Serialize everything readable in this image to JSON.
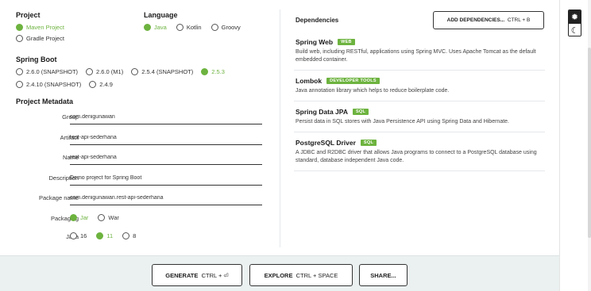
{
  "project": {
    "title": "Project",
    "options": [
      {
        "label": "Maven Project",
        "selected": true
      },
      {
        "label": "Gradle Project",
        "selected": false
      }
    ]
  },
  "language": {
    "title": "Language",
    "options": [
      {
        "label": "Java",
        "selected": true
      },
      {
        "label": "Kotlin",
        "selected": false
      },
      {
        "label": "Groovy",
        "selected": false
      }
    ]
  },
  "spring_boot": {
    "title": "Spring Boot",
    "options": [
      {
        "label": "2.6.0 (SNAPSHOT)",
        "selected": false
      },
      {
        "label": "2.6.0 (M1)",
        "selected": false
      },
      {
        "label": "2.5.4 (SNAPSHOT)",
        "selected": false
      },
      {
        "label": "2.5.3",
        "selected": true
      },
      {
        "label": "2.4.10 (SNAPSHOT)",
        "selected": false
      },
      {
        "label": "2.4.9",
        "selected": false
      }
    ]
  },
  "metadata": {
    "title": "Project Metadata",
    "fields": [
      {
        "label": "Group",
        "value": "com.denigunawan"
      },
      {
        "label": "Artifact",
        "value": "rest-api-sederhana"
      },
      {
        "label": "Name",
        "value": "rest-api-sederhana"
      },
      {
        "label": "Description",
        "value": "Demo project for Spring Boot"
      },
      {
        "label": "Package name",
        "value": "com.denigunawan.rest-api-sederhana"
      }
    ],
    "packaging": {
      "label": "Packaging",
      "options": [
        {
          "label": "Jar",
          "selected": true
        },
        {
          "label": "War",
          "selected": false
        }
      ]
    },
    "java": {
      "label": "Java",
      "options": [
        {
          "label": "16",
          "selected": false
        },
        {
          "label": "11",
          "selected": true
        },
        {
          "label": "8",
          "selected": false
        }
      ]
    }
  },
  "dependencies": {
    "title": "Dependencies",
    "add_button": {
      "label": "ADD DEPENDENCIES...",
      "shortcut": "CTRL + B"
    },
    "items": [
      {
        "name": "Spring Web",
        "badge": "WEB",
        "description": "Build web, including RESTful, applications using Spring MVC. Uses Apache Tomcat as the default embedded container."
      },
      {
        "name": "Lombok",
        "badge": "DEVELOPER TOOLS",
        "description": "Java annotation library which helps to reduce boilerplate code."
      },
      {
        "name": "Spring Data JPA",
        "badge": "SQL",
        "description": "Persist data in SQL stores with Java Persistence API using Spring Data and Hibernate."
      },
      {
        "name": "PostgreSQL Driver",
        "badge": "SQL",
        "description": "A JDBC and R2DBC driver that allows Java programs to connect to a PostgreSQL database using standard, database independent Java code."
      }
    ]
  },
  "footer": {
    "generate": {
      "label": "GENERATE",
      "shortcut": "CTRL + ⏎"
    },
    "explore": {
      "label": "EXPLORE",
      "shortcut": "CTRL + SPACE"
    },
    "share": {
      "label": "SHARE..."
    }
  },
  "sidebar": {
    "light_icon": "sun-icon",
    "dark_icon": "moon-icon"
  },
  "colors": {
    "accent": "#6db33f",
    "footer_bg": "#ebf0f0"
  }
}
